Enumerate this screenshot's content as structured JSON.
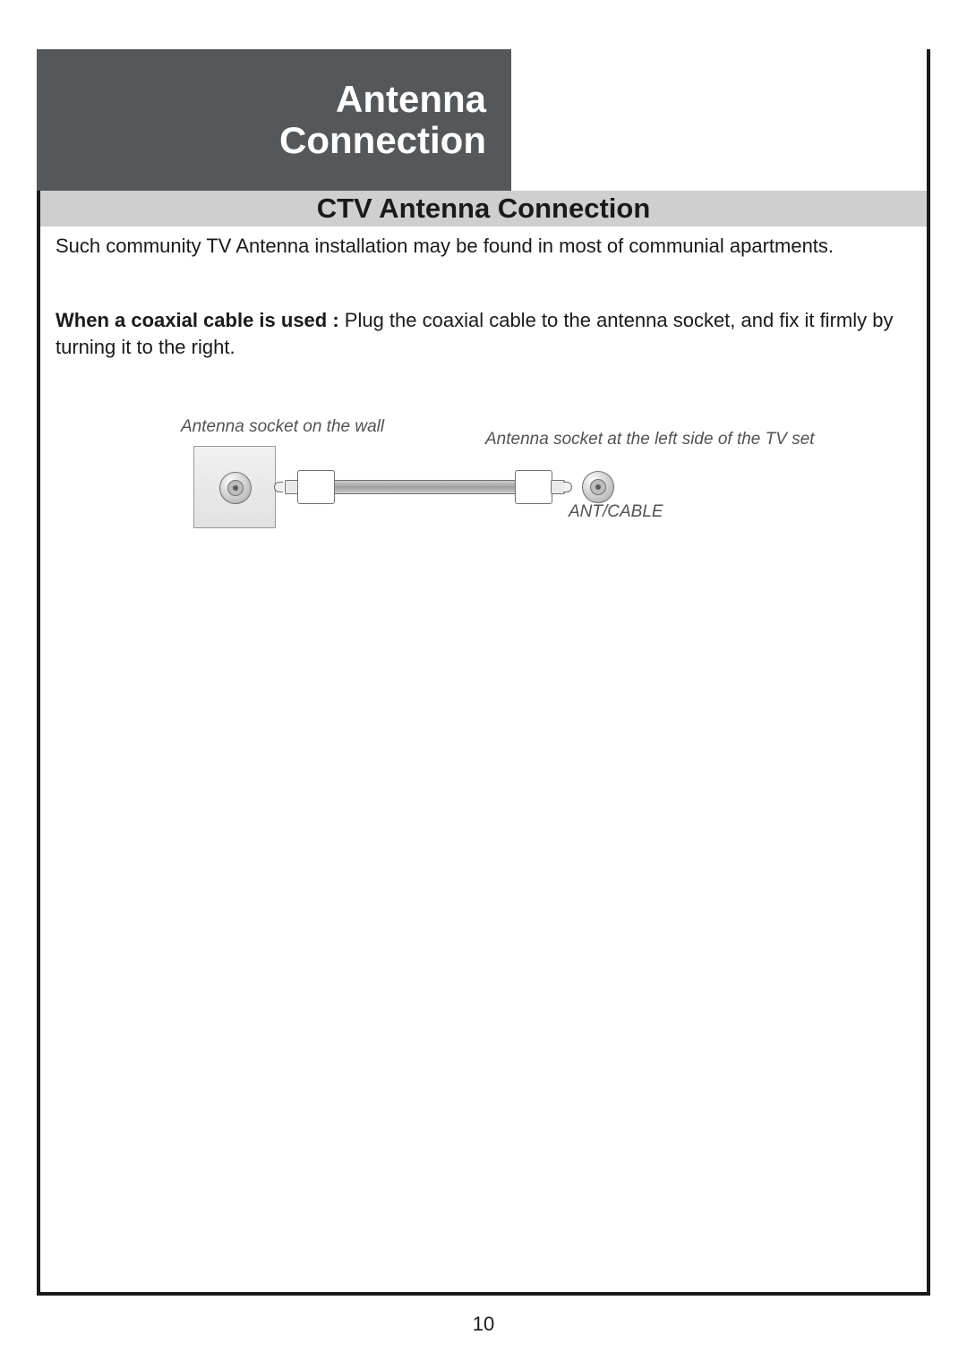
{
  "header": {
    "title_line1": "Antenna",
    "title_line2": "Connection"
  },
  "subtitle": "CTV Antenna Connection",
  "intro": "Such community TV Antenna installation may be found in most of communial apartments.",
  "coax_label": "When a coaxial cable is used : ",
  "coax_text": "Plug the coaxial cable to the antenna socket, and fix it firmly by turning it to the right.",
  "diagram": {
    "wall_label": "Antenna socket on the wall",
    "tv_label": "Antenna socket at the left side of the TV set",
    "port_label": "ANT/CABLE"
  },
  "page_number": "10"
}
